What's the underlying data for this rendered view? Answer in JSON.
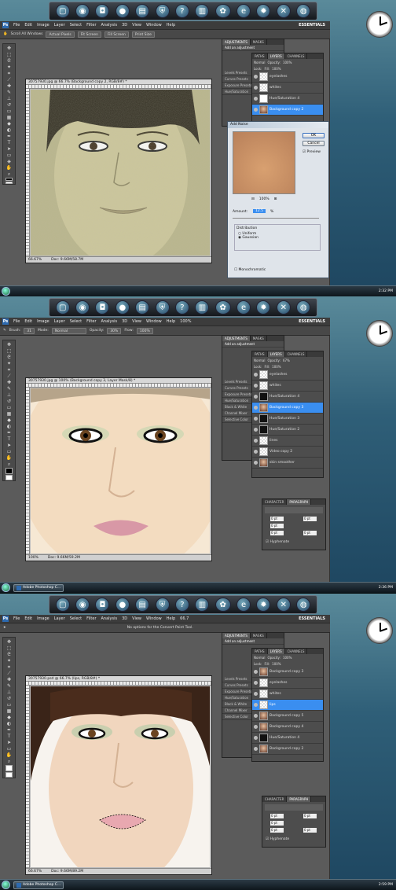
{
  "menu": [
    "File",
    "Edit",
    "Image",
    "Layer",
    "Select",
    "Filter",
    "Analysis",
    "3D",
    "View",
    "Window",
    "Help"
  ],
  "ps_logo": "Ps",
  "workspace": "ESSENTIALS",
  "shot1": {
    "options": {
      "scroll_all": "Scroll All Windows",
      "actual": "Actual Pixels",
      "fit": "Fit Screen",
      "fill": "Fill Screen",
      "print": "Print Size"
    },
    "doc_title": "30757930.jpg @ 66.7% (Background copy 2, RGB/8#) *",
    "zoom": "66.67%",
    "doc_info": "Doc: 9.66M/58.7M",
    "panel_tabs": [
      "ADJUSTMENTS",
      "MASKS"
    ],
    "adj_header": "Add an adjustment",
    "adj_items": [
      "Levels Presets",
      "Curves Presets",
      "Exposure Presets",
      "Hue/Saturation"
    ],
    "layer_tabs": [
      "PATHS",
      "LAYERS",
      "CHANNELS"
    ],
    "blend": "Normal",
    "opacity_label": "Opacity:",
    "opacity": "100%",
    "lock_label": "Lock:",
    "fill_label": "Fill:",
    "fill": "100%",
    "layers": [
      "eyelashes",
      "whites",
      "Hue/Saturation 4",
      "Background copy 2"
    ],
    "dialog": {
      "title": "Add Noise",
      "ok": "OK",
      "cancel": "Cancel",
      "preview": "Preview",
      "zoom": "100%",
      "amount_label": "Amount:",
      "amount": "12.5",
      "unit": "%",
      "dist_label": "Distribution",
      "uniform": "Uniform",
      "gaussian": "Gaussian",
      "mono": "Monochromatic"
    },
    "clock": "2:32 PM"
  },
  "shot2": {
    "taskbar_title": "Adobe Photoshop C...",
    "zoom_menu": "100%",
    "options": {
      "brush_label": "Brush:",
      "brush_size": "31",
      "mode_label": "Mode:",
      "mode": "Normal",
      "opacity_label": "Opacity:",
      "opacity": "30%",
      "flow_label": "Flow:",
      "flow": "100%"
    },
    "doc_title": "30757930.jpg @ 100% (Background copy 3, Layer Mask/8) *",
    "zoom": "100%",
    "doc_info": "Doc: 9.66M/59.2M",
    "adj_header": "Add an adjustment",
    "adj_items": [
      "Levels Presets",
      "Curves Presets",
      "Exposure Presets",
      "Hue/Saturation",
      "Black & White",
      "Channel Mixer",
      "Selective Color"
    ],
    "layer_tabs": [
      "PATHS",
      "LAYERS",
      "CHANNELS"
    ],
    "blend": "Normal",
    "opacity_label": "Opacity:",
    "opacity": "67%",
    "lock_label": "Lock:",
    "fill_label": "Fill:",
    "fill": "100%",
    "layers": [
      "eyelashes",
      "whites",
      "Hue/Saturation 4",
      "Background copy 3",
      "Hue/Saturation 3",
      "Hue/Saturation 2",
      "lines",
      "Video copy 2",
      "skin smoother"
    ],
    "char_tabs": [
      "CHARACTER",
      "PARAGRAPH"
    ],
    "para_fields": [
      "0 pt",
      "0 pt",
      "0 pt",
      "0 pt",
      "0 pt"
    ],
    "hyphenate": "Hyphenate",
    "clock": "2:36 PM"
  },
  "shot3": {
    "taskbar_title": "Adobe Photoshop C...",
    "zoom_menu": "66.7",
    "options_text": "No options for the Convert Point Tool.",
    "doc_title": "30757930.psd @ 66.7% (lips, RGB/8#) *",
    "zoom": "66.67%",
    "doc_info": "Doc: 9.66M/89.2M",
    "adj_header": "Add an adjustment",
    "adj_items": [
      "Levels Presets",
      "Curves Presets",
      "Exposure Presets",
      "Hue/Saturation",
      "Black & White",
      "Channel Mixer",
      "Selective Color"
    ],
    "layer_tabs": [
      "PATHS",
      "LAYERS",
      "CHANNELS"
    ],
    "blend": "Normal",
    "opacity_label": "Opacity:",
    "opacity": "100%",
    "lock_label": "Lock:",
    "fill_label": "Fill:",
    "fill": "100%",
    "layers": [
      "Background copy 3",
      "eyelashes",
      "whites",
      "lips",
      "Background copy 5",
      "Background copy 4",
      "Hue/Saturation 4",
      "Background copy 2"
    ],
    "char_tabs": [
      "CHARACTER",
      "PARAGRAPH"
    ],
    "para_fields": [
      "0 pt",
      "0 pt",
      "0 pt",
      "0 pt",
      "0 pt"
    ],
    "hyphenate": "Hyphenate",
    "clock": "2:59 PM"
  },
  "colors": {
    "accent": "#3a8ef0",
    "ps_bg": "#5b5b5b"
  }
}
